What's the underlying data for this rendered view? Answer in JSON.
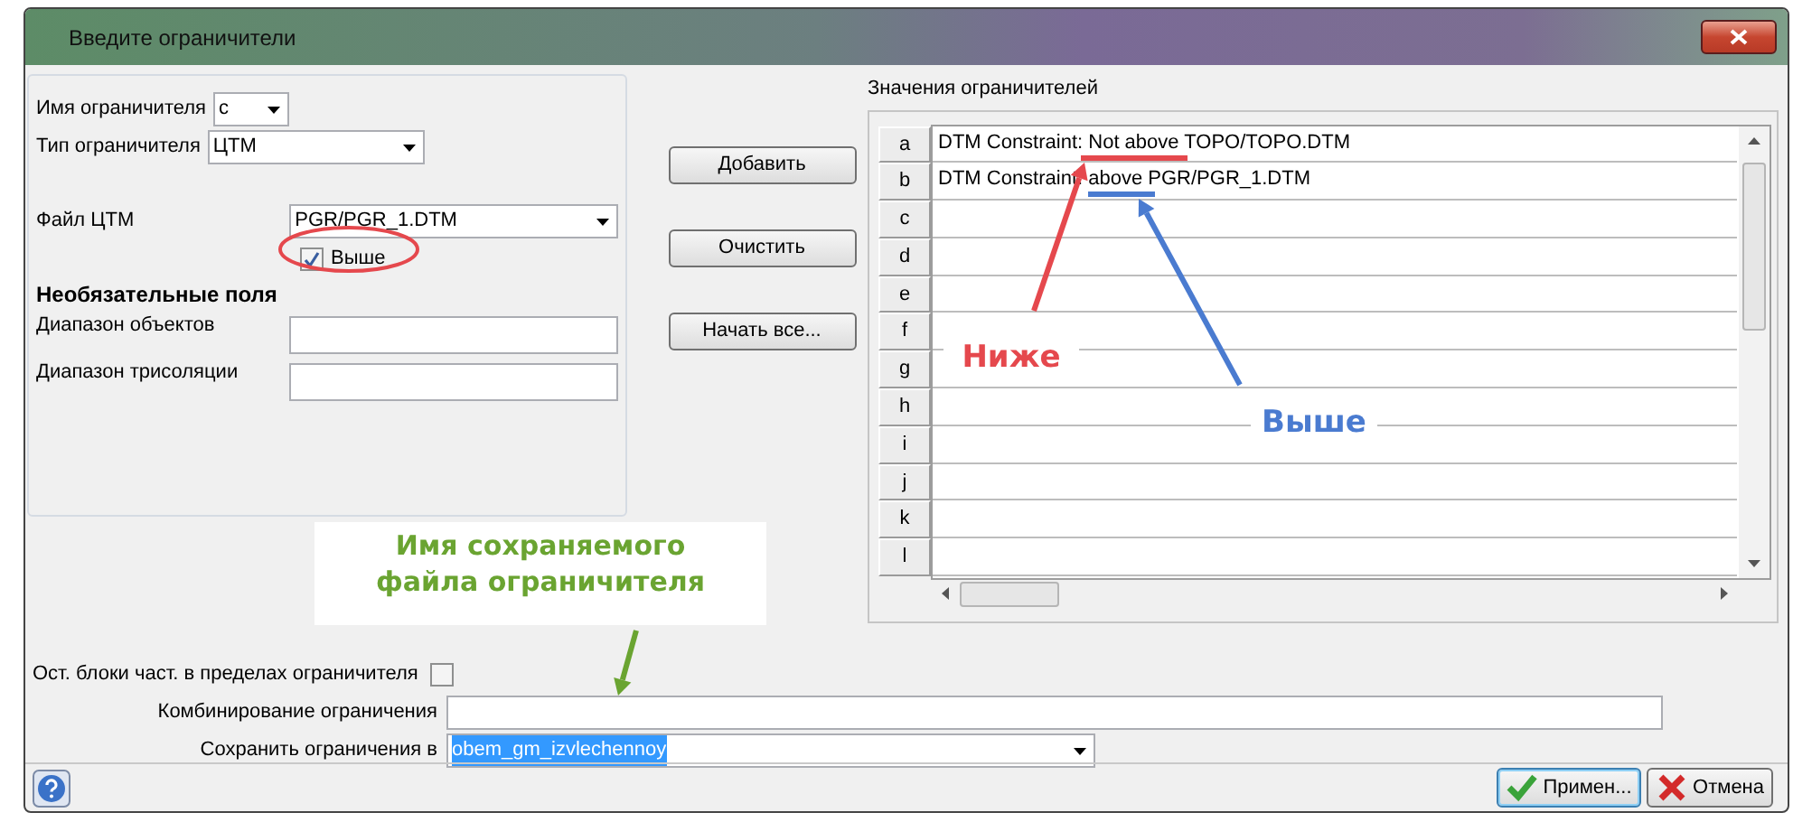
{
  "window": {
    "title": "Введите ограничители"
  },
  "form": {
    "name": {
      "label": "Имя ограничителя",
      "value": "c"
    },
    "type": {
      "label": "Тип ограничителя",
      "value": "ЦТМ"
    },
    "dtm_file": {
      "label": "Файл ЦТМ",
      "value": "PGR/PGR_1.DTM"
    },
    "above": {
      "label": "Выше",
      "checked": true
    },
    "optional_heading": "Необязательные поля",
    "object_range": {
      "label": "Диапазон объектов"
    },
    "trisolation_range": {
      "label": "Диапазон трисоляции"
    }
  },
  "buttons": [
    "Добавить",
    "Очистить",
    "Начать все..."
  ],
  "values": {
    "title": "Значения ограничителей",
    "rows": [
      {
        "key": "a",
        "value": "DTM Constraint: Not above TOPO/TOPO.DTM"
      },
      {
        "key": "b",
        "value": "DTM Constraint: above PGR/PGR_1.DTM"
      },
      {
        "key": "c"
      },
      {
        "key": "d"
      },
      {
        "key": "e"
      },
      {
        "key": "f"
      },
      {
        "key": "g"
      },
      {
        "key": "h"
      },
      {
        "key": "i"
      },
      {
        "key": "j"
      },
      {
        "key": "k"
      },
      {
        "key": "l"
      }
    ]
  },
  "bottom": {
    "blocks": {
      "label": "Ост. блоки част. в пределах ограничителя",
      "checked": false
    },
    "combine": {
      "label": "Комбинирование ограничения"
    },
    "save": {
      "label": "Сохранить ограничения в",
      "value": "obem_gm_izvlechennoy",
      "text_selected": true
    }
  },
  "footer": {
    "buttons": [
      {
        "kind": "apply",
        "label": "Примен..."
      },
      {
        "kind": "cancel",
        "label": "Отмена"
      }
    ]
  },
  "annotations": [
    {
      "text": "Ниже",
      "color": "#e5484d"
    },
    {
      "text": "Выше",
      "color": "#4a7bd0"
    },
    {
      "text": "Имя сохраняемого файла ограничителя",
      "color": "#6aa431"
    }
  ]
}
